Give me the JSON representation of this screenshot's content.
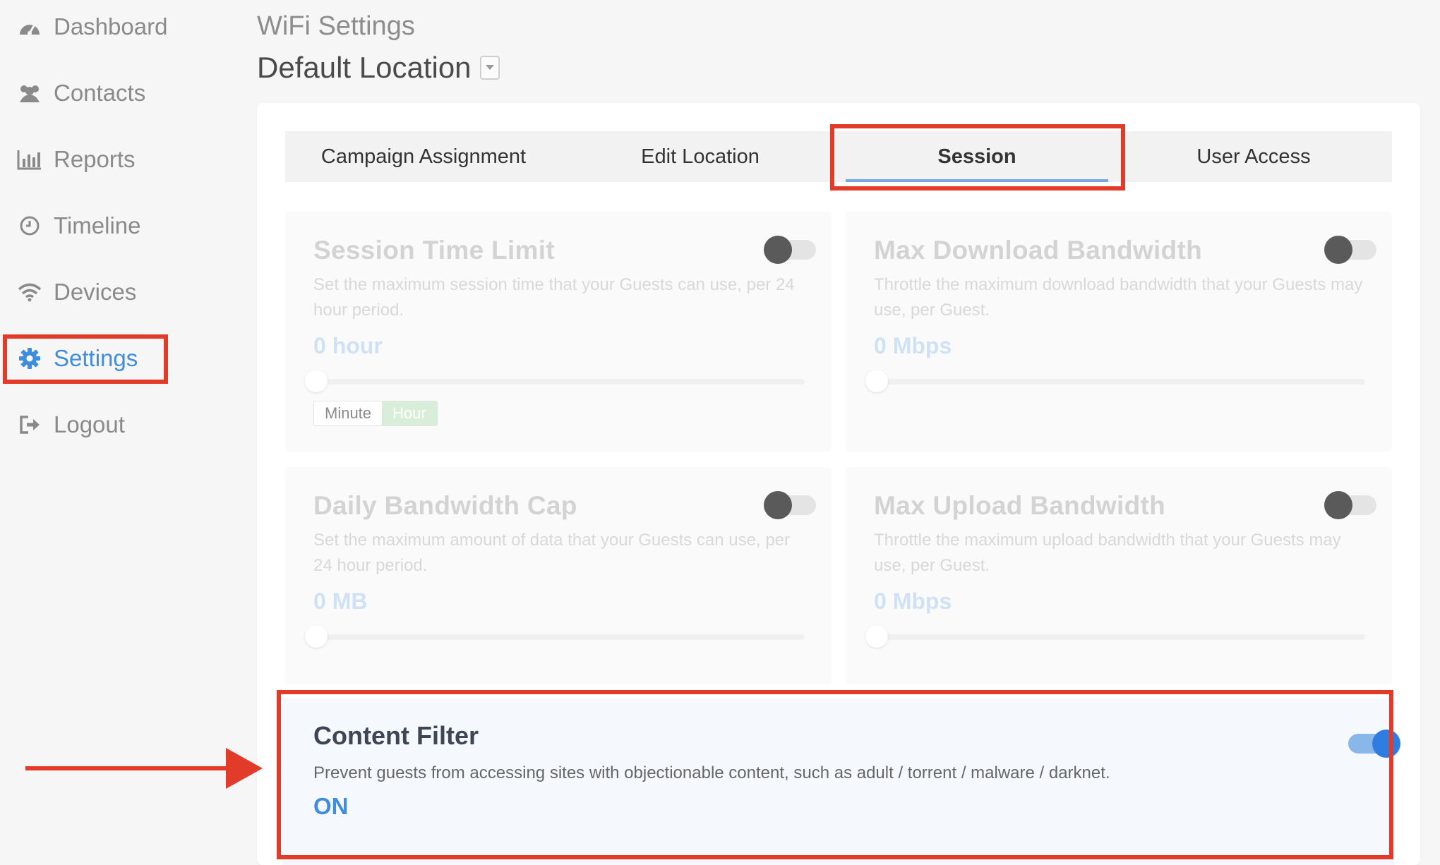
{
  "sidebar": {
    "items": [
      {
        "label": "Dashboard",
        "icon": "dashboard-gauge-icon"
      },
      {
        "label": "Contacts",
        "icon": "users-icon"
      },
      {
        "label": "Reports",
        "icon": "bar-chart-icon"
      },
      {
        "label": "Timeline",
        "icon": "clock-icon"
      },
      {
        "label": "Devices",
        "icon": "wifi-icon"
      },
      {
        "label": "Settings",
        "icon": "gear-icon",
        "active": true
      },
      {
        "label": "Logout",
        "icon": "logout-icon"
      }
    ]
  },
  "header": {
    "breadcrumb": "WiFi Settings",
    "location": "Default Location"
  },
  "tabs": [
    {
      "label": "Campaign Assignment"
    },
    {
      "label": "Edit Location"
    },
    {
      "label": "Session",
      "active": true
    },
    {
      "label": "User Access"
    }
  ],
  "panels": {
    "session_time": {
      "title": "Session Time Limit",
      "description": "Set the maximum session time that your Guests can use, per 24 hour period.",
      "value": "0 hour",
      "enabled": false,
      "units": {
        "minute": "Minute",
        "hour": "Hour",
        "selected": "Hour"
      }
    },
    "max_download": {
      "title": "Max Download Bandwidth",
      "description": "Throttle the maximum download bandwidth that your Guests may use, per Guest.",
      "value": "0 Mbps",
      "enabled": false
    },
    "daily_cap": {
      "title": "Daily Bandwidth Cap",
      "description": "Set the maximum amount of data that your Guests can use, per 24 hour period.",
      "value": "0 MB",
      "enabled": false
    },
    "max_upload": {
      "title": "Max Upload Bandwidth",
      "description": "Throttle the maximum upload bandwidth that your Guests may use, per Guest.",
      "value": "0 Mbps",
      "enabled": false
    },
    "content_filter": {
      "title": "Content Filter",
      "description": "Prevent guests from accessing sites with objectionable content, such as adult / torrent / malware / darknet.",
      "value": "ON",
      "enabled": true
    }
  },
  "colors": {
    "accent": "#3f8ddc",
    "annotation": "#e23b2a",
    "toggle_on": "#2f7de1"
  }
}
